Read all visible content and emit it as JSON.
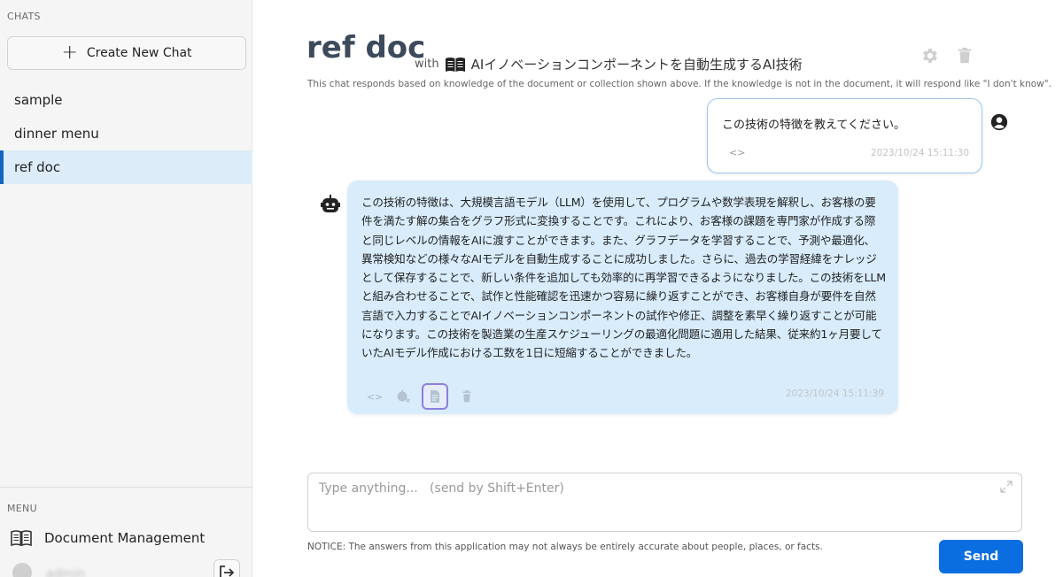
{
  "sidebar": {
    "chats_label": "CHATS",
    "create_button": "Create New Chat",
    "items": [
      {
        "label": "sample"
      },
      {
        "label": "dinner menu"
      },
      {
        "label": "ref doc",
        "active": true
      }
    ],
    "menu_label": "MENU",
    "menu_items": [
      {
        "label": "Document Management",
        "icon": "book-icon"
      }
    ],
    "user_name": "admin"
  },
  "header": {
    "title": "ref doc",
    "with_label": "with",
    "document_name": "AIイノベーションコンポーネントを自動生成するAI技術",
    "subtitle": "This chat responds based on knowledge of the document or collection shown above. If the knowledge is not in the document, it will respond like \"I don't know\"."
  },
  "messages": [
    {
      "role": "user",
      "text": "この技術の特徴を教えてください。",
      "code_icon": "<>",
      "timestamp": "2023/10/24 15:11:30"
    },
    {
      "role": "assistant",
      "text": "この技術の特徴は、大規模言語モデル（LLM）を使用して、プログラムや数学表現を解釈し、お客様の要件を満たす解の集合をグラフ形式に変換することです。これにより、お客様の課題を専門家が作成する際と同じレベルの情報をAIに渡すことができます。また、グラフデータを学習することで、予測や最適化、異常検知などの様々なAIモデルを自動生成することに成功しました。さらに、過去の学習経緯をナレッジとして保存することで、新しい条件を追加しても効率的に再学習できるようになりました。この技術をLLMと組み合わせることで、試作と性能確認を迅速かつ容易に繰り返すことができ、お客様自身が要件を自然言語で入力することでAIイノベーションコンポーネントの試作や修正、調整を素早く繰り返すことが可能になります。この技術を製造業の生産スケジューリングの最適化問題に適用した結果、従来約1ヶ月要していたAIモデル作成における工数を1日に短縮することができました。",
      "code_icon": "<>",
      "timestamp": "2023/10/24 15:11:39"
    }
  ],
  "input": {
    "placeholder": "Type anything...   (send by Shift+Enter)",
    "value": ""
  },
  "notice": "NOTICE: The answers from this application may not always be entirely accurate about people, places, or facts.",
  "send_button": "Send",
  "colors": {
    "accent": "#0b6ee0",
    "assistant_bubble": "#d8ecfb",
    "active_chat_bg": "#dcecf9",
    "title": "#3d4a5c"
  }
}
